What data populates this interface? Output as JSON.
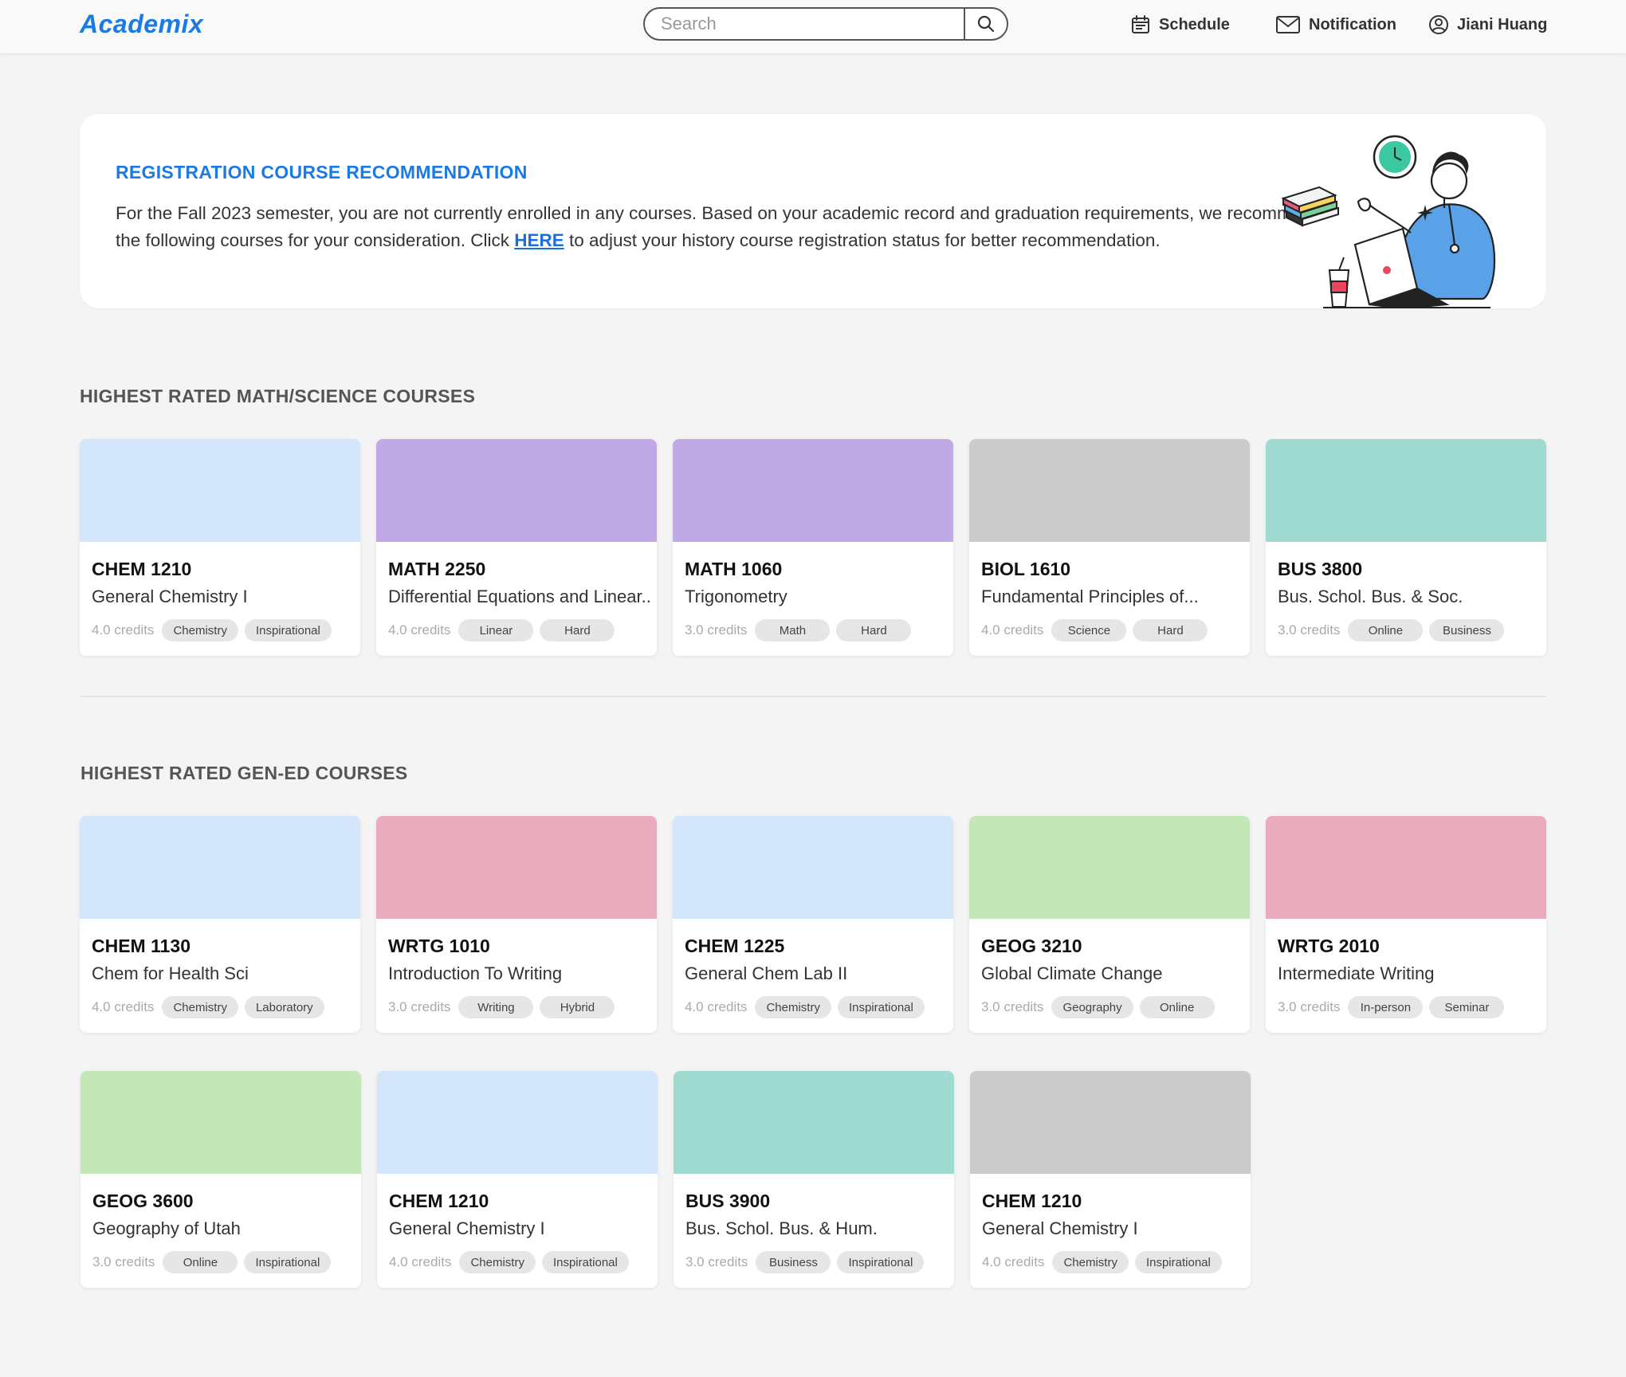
{
  "header": {
    "logo": "Academix",
    "search_placeholder": "Search",
    "nav": {
      "schedule": "Schedule",
      "notification": "Notification",
      "user": "Jiani Huang"
    }
  },
  "recommendation": {
    "title": "REGISTRATION COURSE RECOMMENDATION",
    "text_before_link": "For the Fall 2023 semester, you are not currently enrolled in any courses. Based on your academic record and graduation requirements, we recommend the following courses for your consideration. Click ",
    "link": "HERE",
    "text_after_link": " to adjust your history course registration status for better recommendation."
  },
  "sections": {
    "math_science": {
      "title": "HIGHEST RATED MATH/SCIENCE COURSES",
      "courses": [
        {
          "code": "CHEM 1210",
          "name": "General Chemistry I",
          "credits": "4.0 credits",
          "tags": [
            "Chemistry",
            "Inspirational"
          ],
          "color": "#d4e6fb"
        },
        {
          "code": "MATH 2250",
          "name": "Differential Equations and Linear..",
          "credits": "4.0 credits",
          "tags": [
            "Linear",
            "Hard"
          ],
          "color": "#bfaae5"
        },
        {
          "code": "MATH 1060",
          "name": "Trigonometry",
          "credits": "3.0 credits",
          "tags": [
            "Math",
            "Hard"
          ],
          "color": "#bfaae5"
        },
        {
          "code": "BIOL 1610",
          "name": "Fundamental Principles of...",
          "credits": "4.0 credits",
          "tags": [
            "Science",
            "Hard"
          ],
          "color": "#cbcbcb"
        },
        {
          "code": "BUS 3800",
          "name": "Bus. Schol. Bus. & Soc.",
          "credits": "3.0 credits",
          "tags": [
            "Online",
            "Business"
          ],
          "color": "#a0dbd1"
        }
      ]
    },
    "gen_ed": {
      "title": "HIGHEST RATED GEN-ED COURSES",
      "courses": [
        {
          "code": "CHEM 1130",
          "name": "Chem for Health Sci",
          "credits": "4.0 credits",
          "tags": [
            "Chemistry",
            "Laboratory"
          ],
          "color": "#d4e6fb"
        },
        {
          "code": "WRTG 1010",
          "name": "Introduction To Writing",
          "credits": "3.0 credits",
          "tags": [
            "Writing",
            "Hybrid"
          ],
          "color": "#ebabbe"
        },
        {
          "code": "CHEM 1225",
          "name": "General Chem Lab II",
          "credits": "4.0 credits",
          "tags": [
            "Chemistry",
            "Inspirational"
          ],
          "color": "#d4e6fb"
        },
        {
          "code": "GEOG 3210",
          "name": "Global Climate Change",
          "credits": "3.0 credits",
          "tags": [
            "Geography",
            "Online"
          ],
          "color": "#c3e7b6"
        },
        {
          "code": "WRTG 2010",
          "name": "Intermediate Writing",
          "credits": "3.0 credits",
          "tags": [
            "In-person",
            "Seminar"
          ],
          "color": "#ebabbe"
        },
        {
          "code": "GEOG 3600",
          "name": "Geography of Utah",
          "credits": "3.0 credits",
          "tags": [
            "Online",
            "Inspirational"
          ],
          "color": "#c3e7b6"
        },
        {
          "code": "CHEM 1210",
          "name": "General Chemistry I",
          "credits": "4.0 credits",
          "tags": [
            "Chemistry",
            "Inspirational"
          ],
          "color": "#d4e6fb"
        },
        {
          "code": "BUS 3900",
          "name": "Bus. Schol. Bus. & Hum.",
          "credits": "3.0 credits",
          "tags": [
            "Business",
            "Inspirational"
          ],
          "color": "#a0dbd1"
        },
        {
          "code": "CHEM 1210",
          "name": "General Chemistry I",
          "credits": "4.0 credits",
          "tags": [
            "Chemistry",
            "Inspirational"
          ],
          "color": "#cbcbcb"
        }
      ]
    }
  },
  "colors": {
    "accent": "#1a7ae6",
    "background": "#f4f4f4"
  },
  "icons": {
    "schedule": "calendar-icon",
    "notification": "envelope-icon",
    "user": "user-circle-icon",
    "search": "search-icon"
  }
}
